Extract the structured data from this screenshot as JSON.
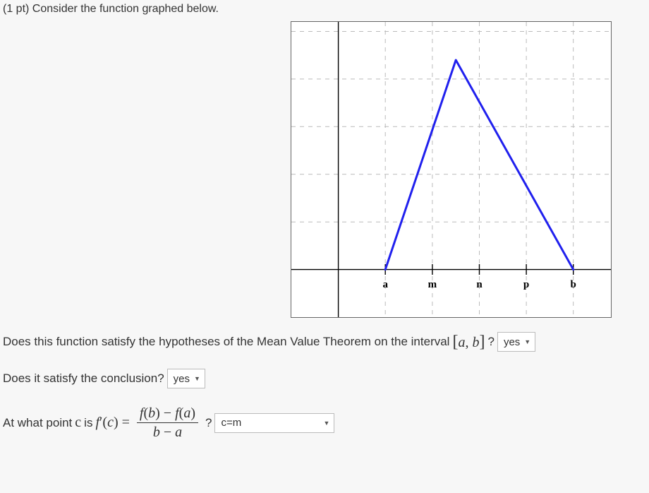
{
  "points": "(1 pt)",
  "prompt": "Consider the function graphed below.",
  "questions": {
    "q1_text": "Does this function satisfy the hypotheses of the Mean Value Theorem on the interval",
    "q1_interval_open": "[",
    "q1_interval_a": "a",
    "q1_interval_comma": ",",
    "q1_interval_b": "b",
    "q1_interval_close": "]",
    "q1_qmark": "?",
    "q1_value": "yes",
    "q2_text": "Does it satisfy the conclusion?",
    "q2_value": "yes",
    "q3_prefix": "At what point",
    "q3_c": "c",
    "q3_is": "is",
    "q3_fprime": "f′(c) =",
    "q3_num_1": "f",
    "q3_num_2": "(b) − f(a)",
    "q3_den_1": "b − a",
    "q3_qmark": "?",
    "q3_value": "c=m"
  },
  "chart_data": {
    "type": "line",
    "xlabel": "",
    "ylabel": "",
    "x_ticks": [
      "a",
      "m",
      "n",
      "p",
      "b"
    ],
    "grid": true,
    "xlim": [
      -1,
      5.8
    ],
    "ylim": [
      -1,
      5.2
    ],
    "series": [
      {
        "name": "f",
        "color": "#2020ee",
        "x": [
          1,
          2.5,
          5
        ],
        "y": [
          0,
          4.4,
          0
        ]
      }
    ],
    "axis_tick_positions": [
      1,
      2,
      3,
      4,
      5
    ]
  }
}
